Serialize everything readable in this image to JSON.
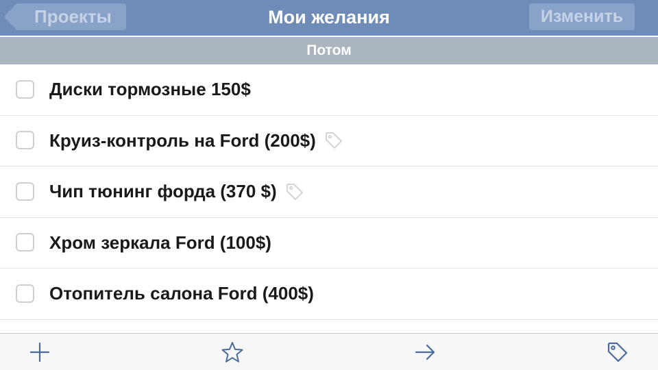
{
  "navbar": {
    "back_label": "Проекты",
    "title": "Мои желания",
    "edit_label": "Изменить"
  },
  "section": {
    "title": "Потом"
  },
  "items": [
    {
      "label": "Диски тормозные 150$",
      "tagged": false
    },
    {
      "label": "Круиз-контроль на Ford (200$)",
      "tagged": true
    },
    {
      "label": "Чип тюнинг форда (370 $)",
      "tagged": true
    },
    {
      "label": "Хром зеркала Ford (100$)",
      "tagged": false
    },
    {
      "label": "Отопитель салона Ford (400$)",
      "tagged": false
    }
  ],
  "toolbar": {
    "icons": [
      "plus-icon",
      "star-icon",
      "arrow-right-icon",
      "tag-icon"
    ]
  },
  "colors": {
    "navbar": "#6f8cb8",
    "section_header": "#aab5c0",
    "accent": "#4a6a98"
  }
}
